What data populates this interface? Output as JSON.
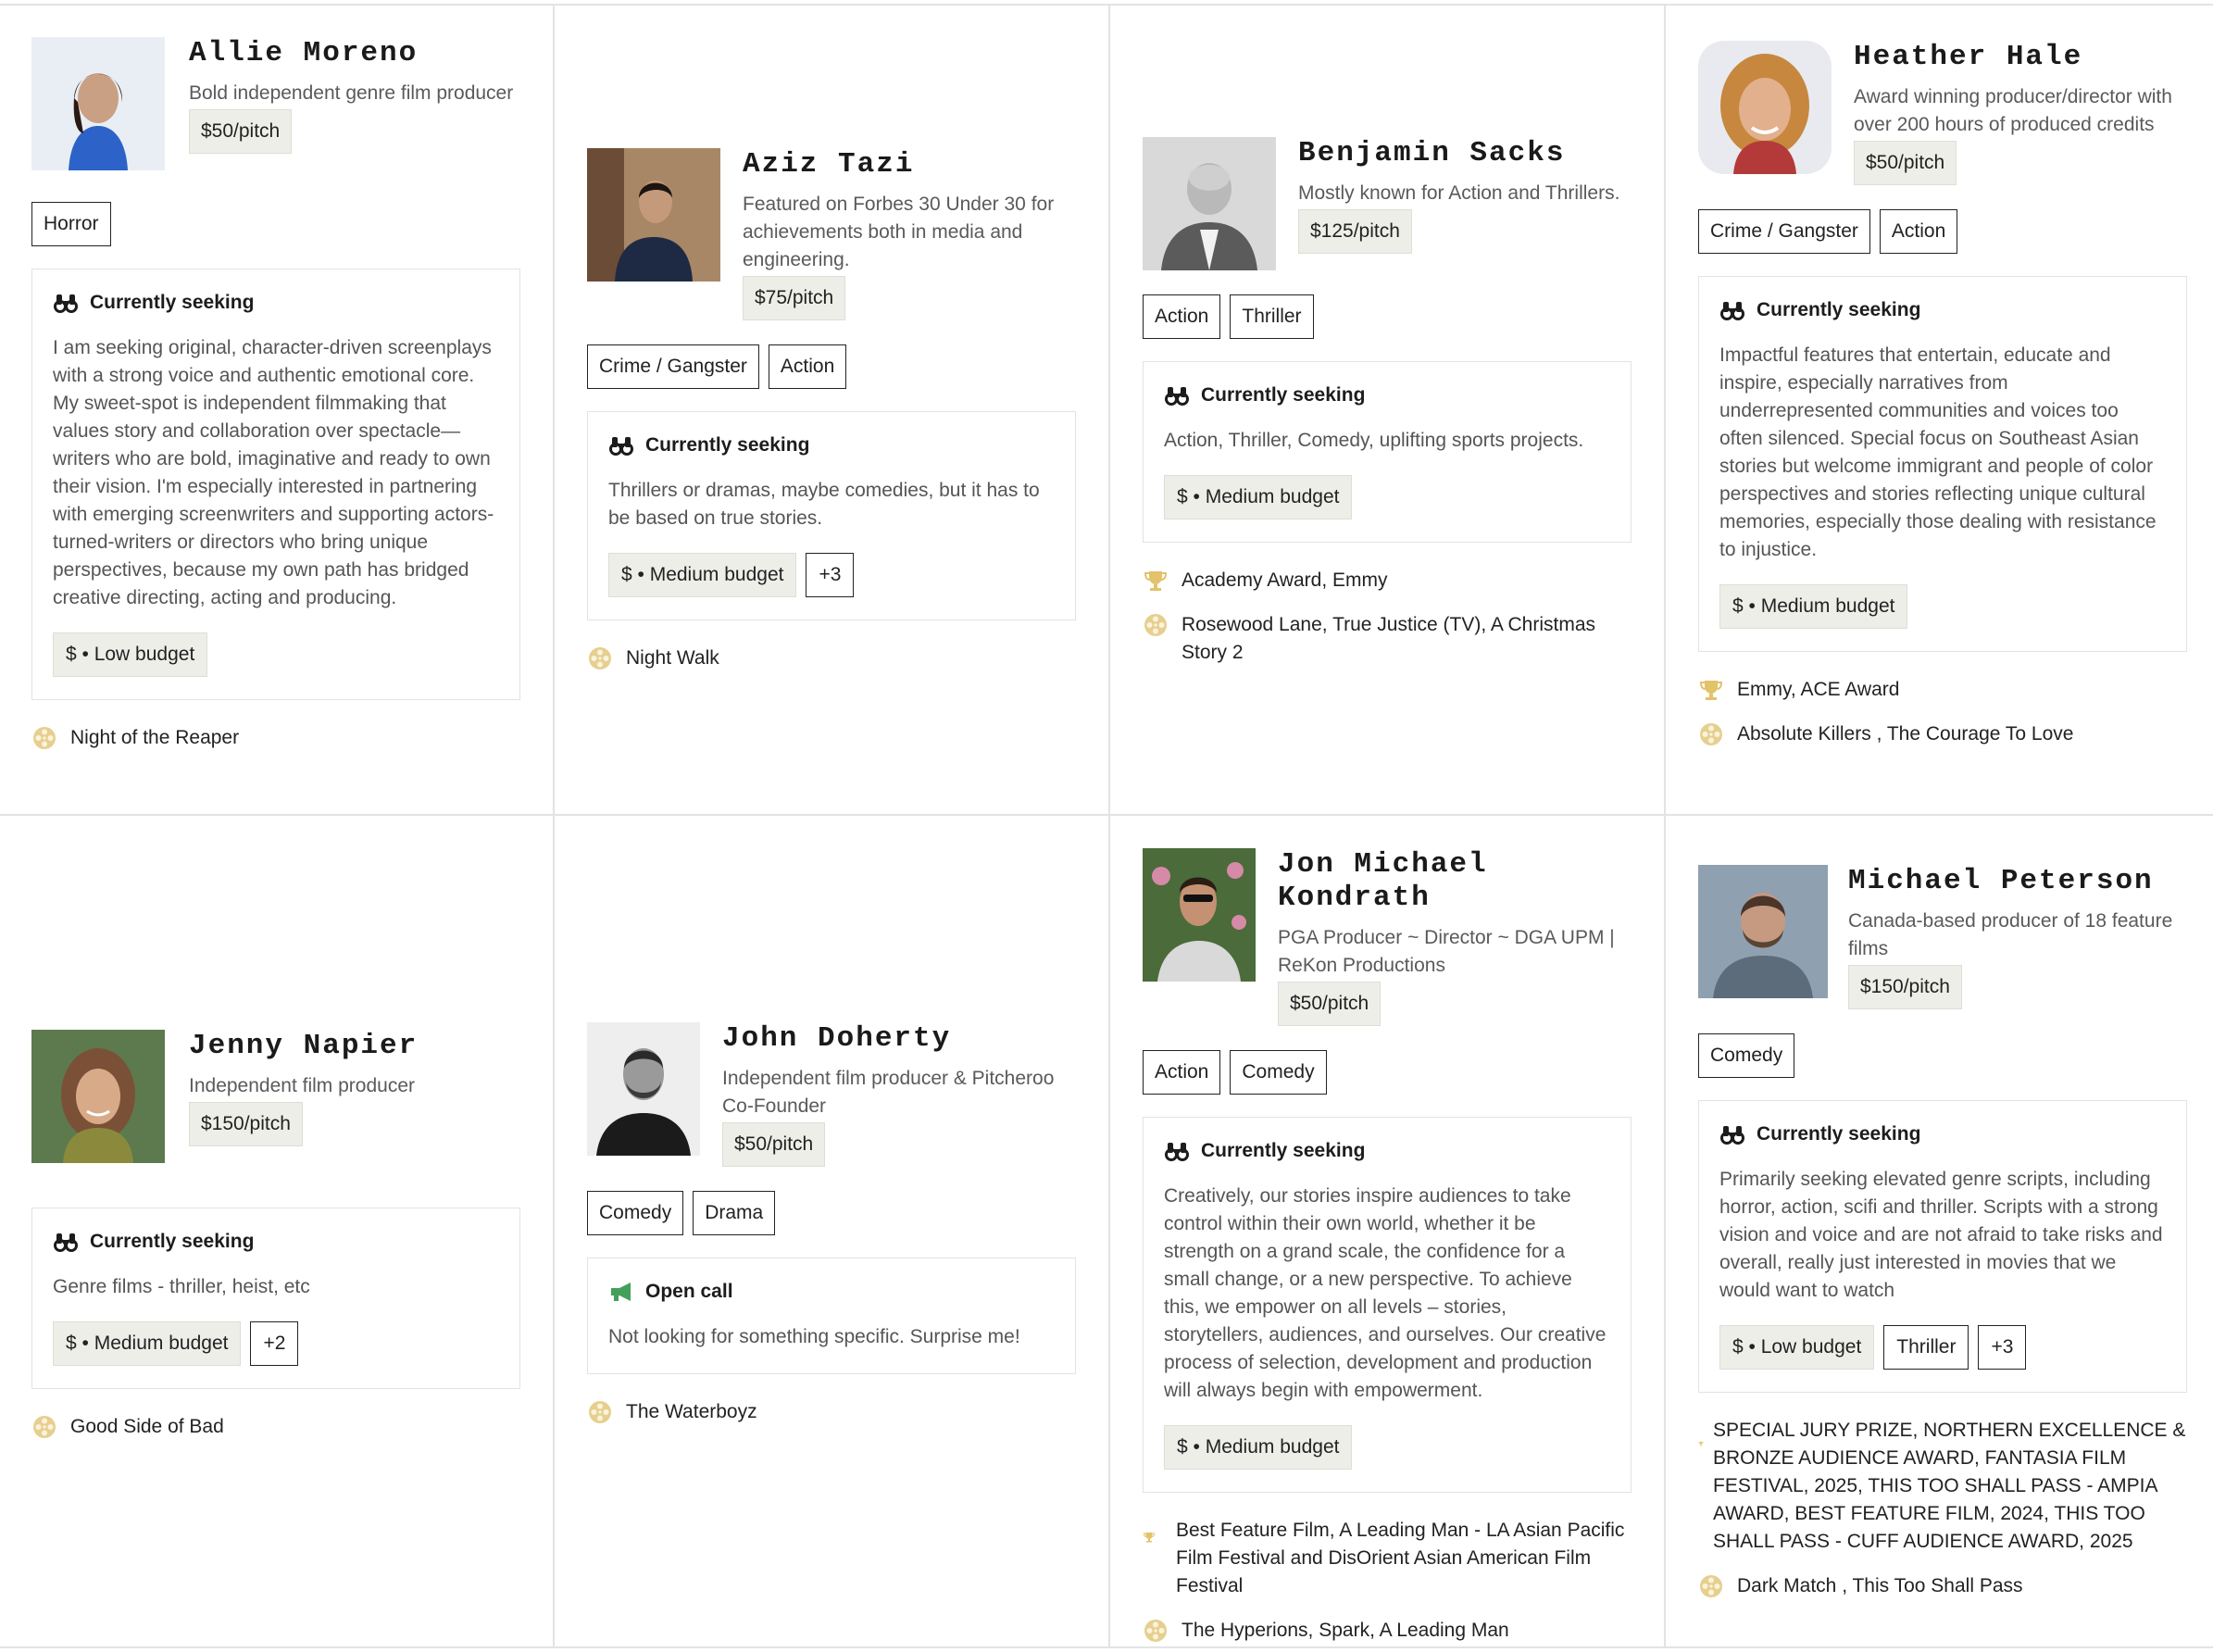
{
  "colors": {
    "accent": "#d9b85c",
    "divider": "#e3e3e3",
    "chip_bg": "#eeeee9",
    "open_call_green": "#43a05a"
  },
  "producers": [
    {
      "name": "Allie Moreno",
      "bio": "Bold independent genre film producer",
      "price": "$50/pitch",
      "genres": [
        "Horror"
      ],
      "section_icon": "binoculars-icon",
      "section_title": "Currently seeking",
      "section_text": "I am seeking original, character-driven screenplays with a strong voice and authentic emotional core. My sweet-spot is independent filmmaking that values story and collaboration over spectacle—writers who are bold, imaginative and ready to own their vision. I'm especially interested in partnering with emerging screenwriters and supporting actors-turned-writers or directors who bring unique perspectives, because my own path has bridged creative directing, acting and producing.",
      "budget": "$ • Low budget",
      "extra_chips": [],
      "awards": "",
      "credits": "Night of the Reaper"
    },
    {
      "name": "Aziz Tazi",
      "bio": "Featured on Forbes 30 Under 30 for achievements both in media and engineering.",
      "price": "$75/pitch",
      "genres": [
        "Crime / Gangster",
        "Action"
      ],
      "section_icon": "binoculars-icon",
      "section_title": "Currently seeking",
      "section_text": "Thrillers or dramas, maybe comedies, but it has to be based on true stories.",
      "budget": "$ • Medium budget",
      "extra_chips": [
        "+3"
      ],
      "awards": "",
      "credits": "Night Walk"
    },
    {
      "name": "Benjamin Sacks",
      "bio": "Mostly known for Action and Thrillers.",
      "price": "$125/pitch",
      "genres": [
        "Action",
        "Thriller"
      ],
      "section_icon": "binoculars-icon",
      "section_title": "Currently seeking",
      "section_text": "Action, Thriller, Comedy, uplifting sports projects.",
      "budget": "$ • Medium budget",
      "extra_chips": [],
      "awards": "Academy Award, Emmy",
      "credits": "Rosewood Lane, True Justice (TV), A Christmas Story 2"
    },
    {
      "name": "Heather Hale",
      "bio": "Award winning producer/director with over 200 hours of produced credits",
      "price": "$50/pitch",
      "genres": [
        "Crime / Gangster",
        "Action"
      ],
      "section_icon": "binoculars-icon",
      "section_title": "Currently seeking",
      "section_text": "Impactful features that entertain, educate and inspire, especially narratives from underrepresented communities and voices too often silenced. Special focus on Southeast Asian stories but welcome immigrant and people of color perspectives and stories reflecting unique cultural memories, especially those dealing with resistance to injustice.",
      "budget": "$ • Medium budget",
      "extra_chips": [],
      "awards": "Emmy, ACE Award",
      "credits": "Absolute Killers , The Courage To Love"
    },
    {
      "name": "Jenny Napier",
      "bio": "Independent film producer",
      "price": "$150/pitch",
      "genres": [],
      "section_icon": "binoculars-icon",
      "section_title": "Currently seeking",
      "section_text": "Genre films - thriller, heist, etc",
      "budget": "$ • Medium budget",
      "extra_chips": [
        "+2"
      ],
      "awards": "",
      "credits": "Good Side of Bad"
    },
    {
      "name": "John Doherty",
      "bio": "Independent film producer & Pitcheroo Co-Founder",
      "price": "$50/pitch",
      "genres": [
        "Comedy",
        "Drama"
      ],
      "section_icon": "megaphone-icon",
      "section_title": "Open call",
      "section_text": "Not looking for something specific. Surprise me!",
      "budget": "",
      "extra_chips": [],
      "awards": "",
      "credits": "The Waterboyz"
    },
    {
      "name": "Jon Michael Kondrath",
      "bio": "PGA Producer ~ Director ~ DGA UPM | ReKon Productions",
      "price": "$50/pitch",
      "genres": [
        "Action",
        "Comedy"
      ],
      "section_icon": "binoculars-icon",
      "section_title": "Currently seeking",
      "section_text": "Creatively, our stories inspire audiences to take control within their own world, whether it be strength on a grand scale, the confidence for a small change, or a new perspective. To achieve this, we empower on all levels – stories, storytellers, audiences, and ourselves. Our creative process of selection, development and production will always begin with empowerment.",
      "budget": "$ • Medium budget",
      "extra_chips": [],
      "awards": "Best Feature Film, A Leading Man - LA Asian Pacific Film Festival and DisOrient Asian American Film Festival",
      "credits": "The Hyperions, Spark, A Leading Man"
    },
    {
      "name": "Michael Peterson",
      "bio": "Canada-based producer of 18 feature films",
      "price": "$150/pitch",
      "genres": [
        "Comedy"
      ],
      "section_icon": "binoculars-icon",
      "section_title": "Currently seeking",
      "section_text": "Primarily seeking elevated genre scripts, including horror, action, scifi and thriller.  Scripts with a strong vision and voice and are not afraid to take risks and overall, really just interested in movies that we would want to watch",
      "budget": "$ • Low budget",
      "extra_chips": [
        "Thriller",
        "+3"
      ],
      "awards": "SPECIAL JURY PRIZE, NORTHERN EXCELLENCE & BRONZE AUDIENCE AWARD, FANTASIA FILM FESTIVAL, 2025, THIS TOO SHALL PASS - AMPIA AWARD, BEST FEATURE FILM, 2024, THIS TOO SHALL PASS - CUFF AUDIENCE AWARD, 2025",
      "credits": "Dark Match , This Too Shall Pass"
    }
  ]
}
